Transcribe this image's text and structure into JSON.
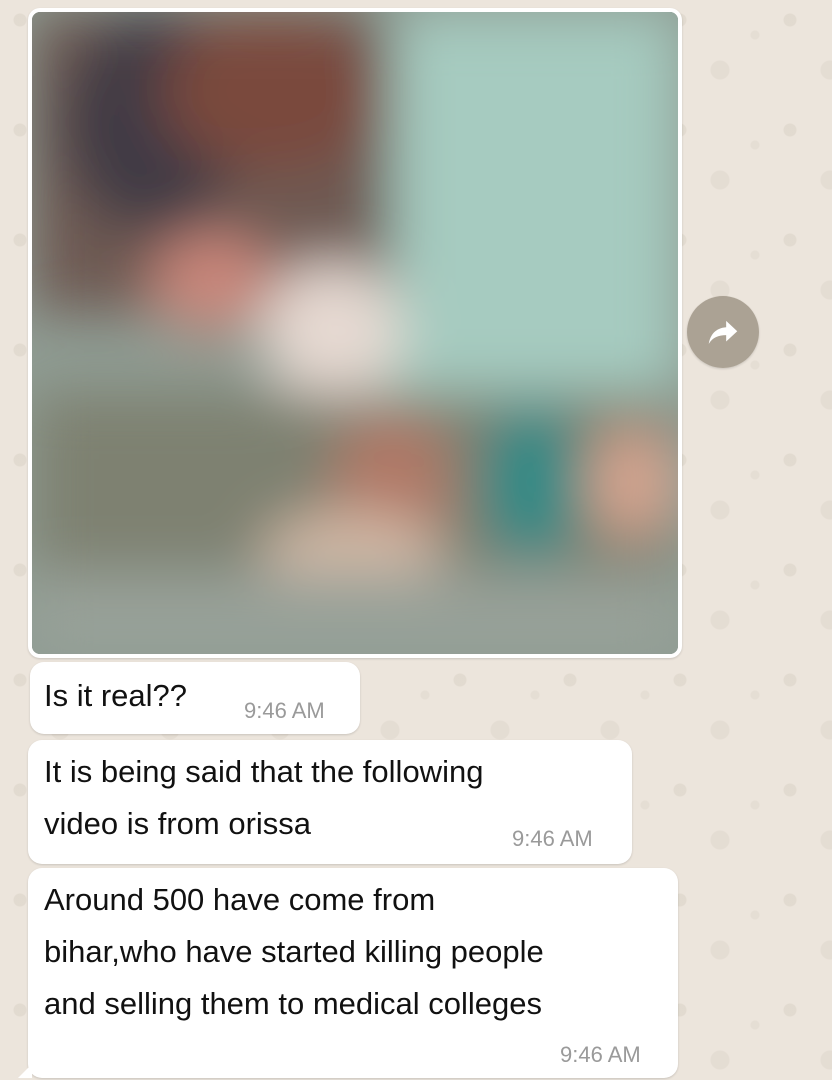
{
  "chat": {
    "image_message": {
      "media_type": "blurred-image",
      "forward_icon": "forward-arrow-icon"
    },
    "messages": [
      {
        "text": "Is it real??",
        "time": "9:46 AM"
      },
      {
        "text": "It is being said that the following\nvideo is from orissa",
        "time": "9:46 AM"
      },
      {
        "text": "Around 500 have come from\nbihar,who have started killing people\nand selling them to medical colleges",
        "time": "9:46 AM"
      }
    ]
  },
  "colors": {
    "wallpaper": "#ece5dc",
    "bubble": "#ffffff",
    "timestamp": "#9a9a9a",
    "forward_button": "#a0968a"
  }
}
